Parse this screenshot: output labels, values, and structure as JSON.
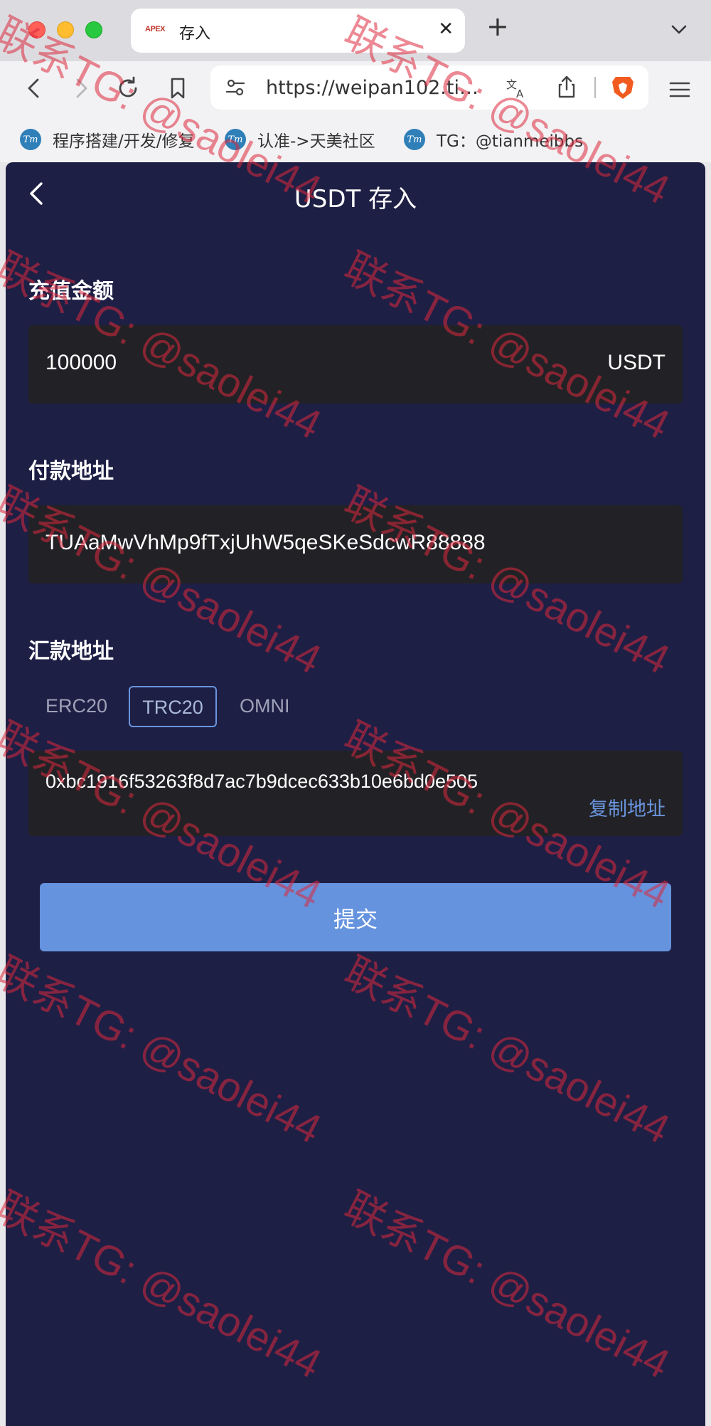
{
  "browser": {
    "tab": {
      "favicon_text": "APEX",
      "title": "存入"
    },
    "url": "https://weipan102.timi...",
    "bookmarks": [
      {
        "icon_text": "Tm",
        "label": "程序搭建/开发/修复"
      },
      {
        "icon_text": "Tm",
        "label": "认准->天美社区"
      },
      {
        "icon_text": "Tm",
        "label": "TG：@tianmeibbs"
      }
    ]
  },
  "page": {
    "title": "USDT 存入",
    "amount": {
      "label": "充值金额",
      "value": "100000",
      "unit": "USDT"
    },
    "payer": {
      "label": "付款地址",
      "value": "TUAaMwVhMp9fTxjUhW5qeSKeSdcwR88888"
    },
    "remit": {
      "label": "汇款地址",
      "chains": [
        "ERC20",
        "TRC20",
        "OMNI"
      ],
      "selected_chain": "TRC20",
      "address": "0xbc1916f53263f8d7ac7b9dcec633b10e6bd0e505",
      "copy_label": "复制地址"
    },
    "submit_label": "提交"
  },
  "watermark": {
    "text": "联系TG: @saolei44",
    "color": "#dc283c"
  },
  "colors": {
    "app_bg": "#1e1f45",
    "field_bg": "#222226",
    "accent": "#6593de"
  },
  "icons": [
    "back-arrow-icon",
    "forward-arrow-icon",
    "reload-icon",
    "bookmark-icon",
    "site-settings-icon",
    "translate-icon",
    "share-icon",
    "brave-shield-icon",
    "menu-icon",
    "chevron-down-icon",
    "close-icon",
    "plus-icon"
  ]
}
